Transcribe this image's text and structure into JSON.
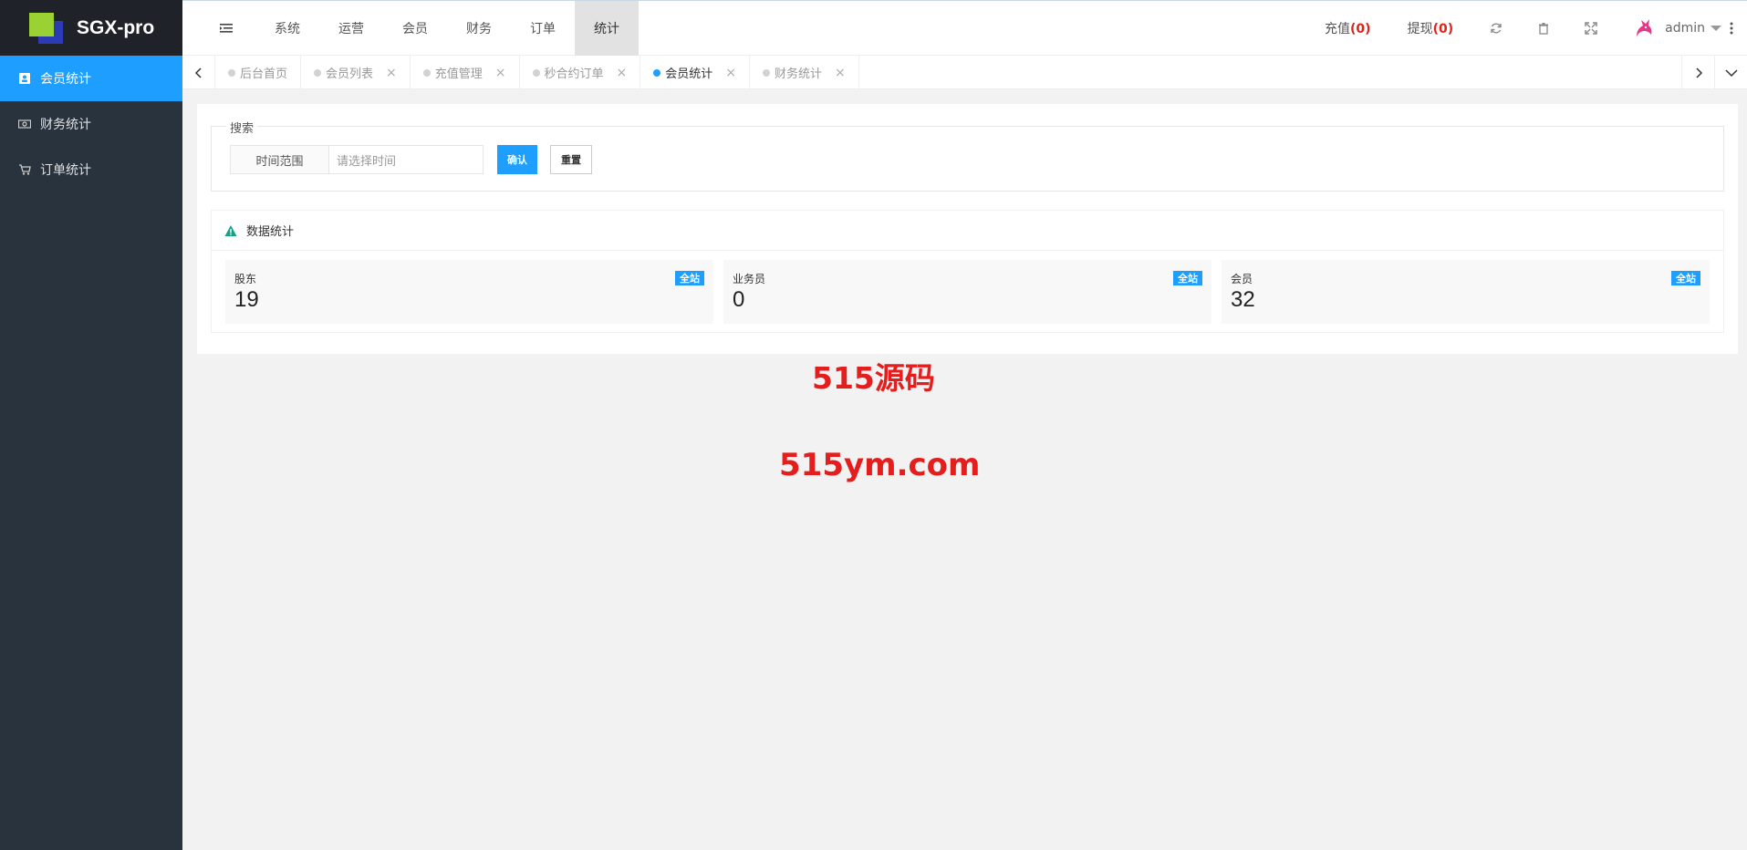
{
  "app": {
    "title": "SGX-pro"
  },
  "sidebar": {
    "items": [
      {
        "label": "会员统计",
        "icon": "user-card-icon",
        "active": true
      },
      {
        "label": "财务统计",
        "icon": "money-icon",
        "active": false
      },
      {
        "label": "订单统计",
        "icon": "cart-icon",
        "active": false
      }
    ]
  },
  "header": {
    "nav": [
      {
        "label": "系统",
        "active": false
      },
      {
        "label": "运营",
        "active": false
      },
      {
        "label": "会员",
        "active": false
      },
      {
        "label": "财务",
        "active": false
      },
      {
        "label": "订单",
        "active": false
      },
      {
        "label": "统计",
        "active": true
      }
    ],
    "recharge_label": "充值",
    "recharge_count": "(0)",
    "withdraw_label": "提现",
    "withdraw_count": "(0)",
    "username": "admin"
  },
  "tabs": [
    {
      "label": "后台首页",
      "closable": false,
      "active": false
    },
    {
      "label": "会员列表",
      "closable": true,
      "active": false
    },
    {
      "label": "充值管理",
      "closable": true,
      "active": false
    },
    {
      "label": "秒合约订单",
      "closable": true,
      "active": false
    },
    {
      "label": "会员统计",
      "closable": true,
      "active": true
    },
    {
      "label": "财务统计",
      "closable": true,
      "active": false
    }
  ],
  "search": {
    "legend": "搜索",
    "time_range_label": "时间范围",
    "time_placeholder": "请选择时间",
    "confirm_label": "确认",
    "reset_label": "重置"
  },
  "stats": {
    "title": "数据统计",
    "cards": [
      {
        "label": "股东",
        "value": "19",
        "badge": "全站"
      },
      {
        "label": "业务员",
        "value": "0",
        "badge": "全站"
      },
      {
        "label": "会员",
        "value": "32",
        "badge": "全站"
      }
    ]
  },
  "watermark": {
    "line1": "515源码",
    "line2": "515ym.com"
  },
  "colors": {
    "accent": "#1e9fff",
    "sidebar_bg": "#28333e",
    "count_red": "#e0231a",
    "watermark_red": "#e41d1d"
  }
}
